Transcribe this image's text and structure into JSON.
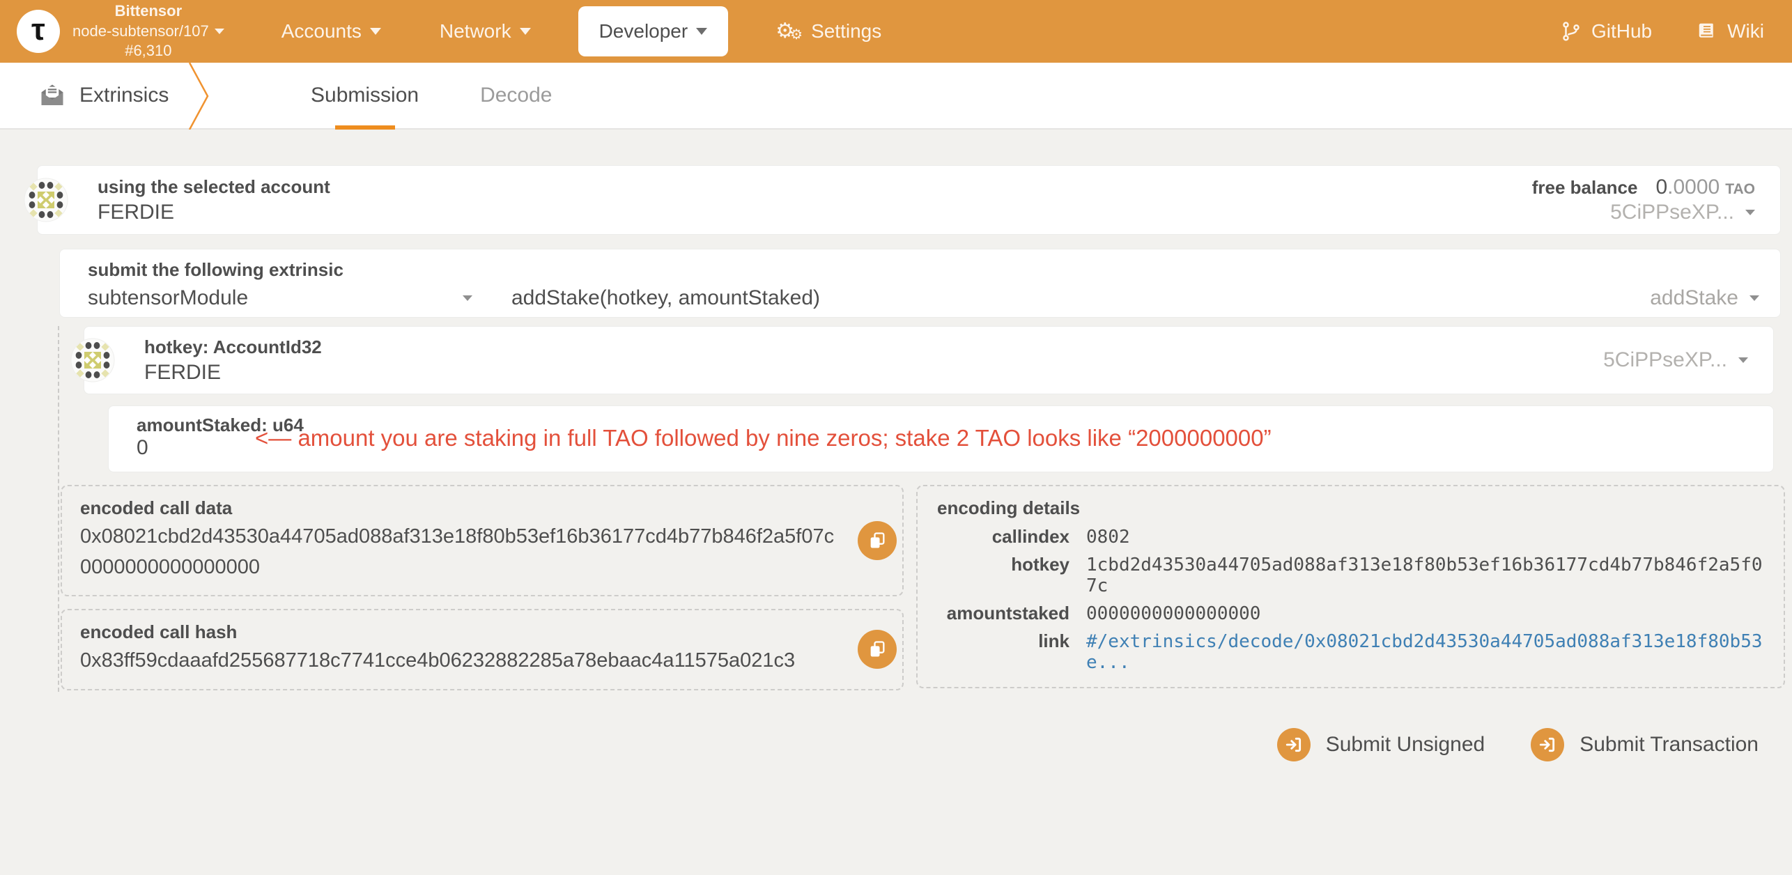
{
  "colors": {
    "accent_orange": "#e0963f",
    "tab_underline_orange": "#ee8d1f",
    "annotation_red": "#e3503b",
    "link_blue": "#3f80b4",
    "identicon_olive": "#cfcc6f",
    "identicon_dot_gray": "#4d4d4d"
  },
  "header": {
    "logo_glyph": "τ",
    "chain_name": "Bittensor",
    "node_version": "node-subtensor/107",
    "block_number": "#6,310",
    "nav": [
      {
        "label": "Accounts"
      },
      {
        "label": "Network"
      },
      {
        "label": "Developer"
      },
      {
        "label": "Settings"
      }
    ],
    "links": [
      {
        "label": "GitHub"
      },
      {
        "label": "Wiki"
      }
    ]
  },
  "tabbar": {
    "section": "Extrinsics",
    "tabs": [
      {
        "label": "Submission"
      },
      {
        "label": "Decode"
      }
    ]
  },
  "account_row": {
    "label": "using the selected account",
    "account_name": "FERDIE",
    "free_balance_label": "free balance",
    "balance_int": "0",
    "balance_frac": ".0000",
    "balance_unit": "TAO",
    "address_short": "5CiPPseXP..."
  },
  "extrinsic": {
    "label": "submit the following extrinsic",
    "module": "subtensorModule",
    "call_signature": "addStake(hotkey, amountStaked)",
    "call_selected": "addStake",
    "params": {
      "hotkey": {
        "label": "hotkey: AccountId32",
        "account_name": "FERDIE",
        "address_short": "5CiPPseXP..."
      },
      "amount": {
        "label": "amountStaked: u64",
        "value": "0",
        "annotation": "<— amount you are staking in full TAO followed by nine zeros; stake 2 TAO looks like “2000000000”"
      }
    }
  },
  "encoded_call_data": {
    "label": "encoded call data",
    "value": "0x08021cbd2d43530a44705ad088af313e18f80b53ef16b36177cd4b77b846f2a5f07c0000000000000000"
  },
  "encoded_call_hash": {
    "label": "encoded call hash",
    "value": "0x83ff59cdaaafd255687718c7741cce4b06232882285a78ebaac4a11575a021c3"
  },
  "encoding_details": {
    "label": "encoding details",
    "rows": [
      {
        "key": "callindex",
        "value": "0802"
      },
      {
        "key": "hotkey",
        "value": "1cbd2d43530a44705ad088af313e18f80b53ef16b36177cd4b77b846f2a5f07c"
      },
      {
        "key": "amountstaked",
        "value": "0000000000000000"
      },
      {
        "key": "link",
        "value": "#/extrinsics/decode/0x08021cbd2d43530a44705ad088af313e18f80b53e..."
      }
    ]
  },
  "actions": {
    "submit_unsigned": "Submit Unsigned",
    "submit_transaction": "Submit Transaction"
  }
}
